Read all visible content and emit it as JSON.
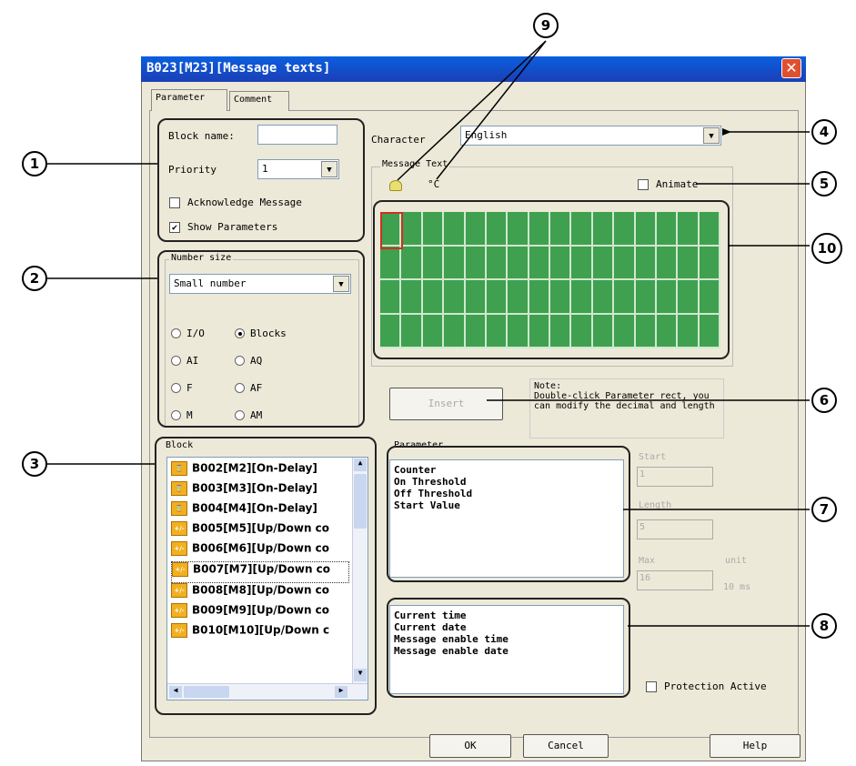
{
  "window": {
    "title": "B023[M23][Message texts]",
    "close_symbol": "✕"
  },
  "tabs": [
    {
      "label": "Parameter"
    },
    {
      "label": "Comment"
    }
  ],
  "block_settings": {
    "block_name_label": "Block name:",
    "block_name_value": "",
    "priority_label": "Priority",
    "priority_value": "1",
    "acknowledge_label": "Acknowledge Message",
    "acknowledge_checked": false,
    "show_params_label": "Show Parameters",
    "show_params_checked": true
  },
  "number_size": {
    "group_label": "Number size",
    "selected": "Small number",
    "radios": [
      {
        "label": "I/O",
        "selected": false
      },
      {
        "label": "Blocks",
        "selected": true
      },
      {
        "label": "AI",
        "selected": false
      },
      {
        "label": "AQ",
        "selected": false
      },
      {
        "label": "F",
        "selected": false
      },
      {
        "label": "AF",
        "selected": false
      },
      {
        "label": "M",
        "selected": false
      },
      {
        "label": "AM",
        "selected": false
      }
    ]
  },
  "block_list": {
    "group_label": "Block",
    "items": [
      {
        "label": "B002[M2][On-Delay]",
        "icon": "on-delay-icon"
      },
      {
        "label": "B003[M3][On-Delay]",
        "icon": "on-delay-icon"
      },
      {
        "label": "B004[M4][On-Delay]",
        "icon": "on-delay-icon"
      },
      {
        "label": "B005[M5][Up/Down co",
        "icon": "counter-icon"
      },
      {
        "label": "B006[M6][Up/Down co",
        "icon": "counter-icon"
      },
      {
        "label": "B007[M7][Up/Down co",
        "icon": "counter-icon"
      },
      {
        "label": "B008[M8][Up/Down co",
        "icon": "counter-icon"
      },
      {
        "label": "B009[M9][Up/Down co",
        "icon": "counter-icon"
      },
      {
        "label": "B010[M10][Up/Down c",
        "icon": "counter-icon"
      }
    ]
  },
  "character": {
    "label": "Character",
    "value": "English"
  },
  "message_text": {
    "group_label": "Message Text",
    "degree_symbol": "°C",
    "animate_label": "Animate",
    "animate_checked": false
  },
  "insert_button": "Insert",
  "note": {
    "title": "Note:",
    "text": " Double-click Parameter rect, you can modify the decimal and length"
  },
  "parameter": {
    "group_label": "Parameter",
    "items": [
      "Counter",
      "On Threshold",
      "Off Threshold",
      "Start Value"
    ]
  },
  "param_fields": {
    "start_label": "Start",
    "start_value": "1",
    "length_label": "Length",
    "length_value": "5",
    "max_label": "Max",
    "max_value": "16",
    "unit_label": "unit",
    "unit_value": "10 ms"
  },
  "special_items": [
    "Current time",
    "Current date",
    "Message enable time",
    "Message enable date"
  ],
  "protection": {
    "label": "Protection Active",
    "checked": false
  },
  "buttons": {
    "ok": "OK",
    "cancel": "Cancel",
    "help": "Help"
  },
  "callouts": [
    "1",
    "2",
    "3",
    "4",
    "5",
    "6",
    "7",
    "8",
    "9",
    "10"
  ],
  "colors": {
    "title_bar": "#1b3fb6",
    "lcd_green": "#3fa04f",
    "close_red": "#e0502e"
  }
}
